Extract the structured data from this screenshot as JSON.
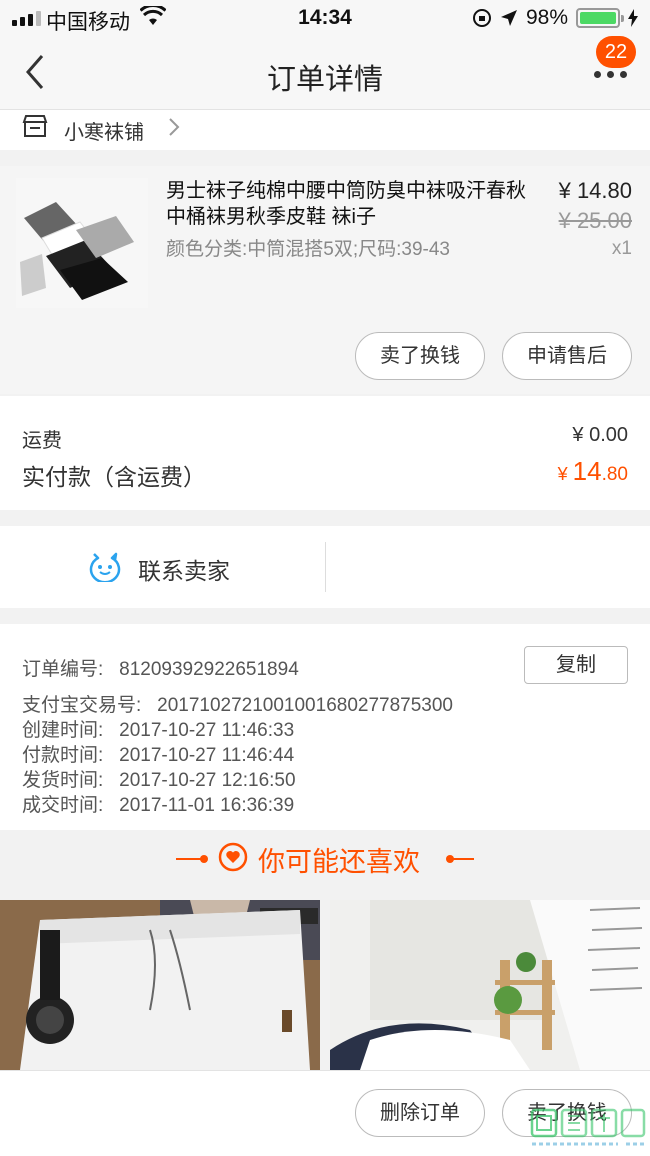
{
  "status_bar": {
    "carrier": "中国移动",
    "time": "14:34",
    "battery": "98%"
  },
  "nav": {
    "title": "订单详情",
    "badge_count": "22"
  },
  "shop": {
    "name": "小寒袜铺"
  },
  "product": {
    "title": "男士袜子纯棉中腰中筒防臭中袜吸汗春秋中桶袜男秋季皮鞋 袜i子",
    "sku": "颜色分类:中筒混搭5双;尺码:39-43",
    "price": "¥ 14.80",
    "original_price": "¥ 25.00",
    "quantity": "x1",
    "actions": [
      "卖了换钱",
      "申请售后"
    ]
  },
  "fees": {
    "shipping_label": "运费",
    "shipping_value": "¥ 0.00",
    "paid_label": "实付款（含运费）",
    "paid_symbol": "¥ ",
    "paid_int": "14",
    "paid_dec": ".80"
  },
  "contact": {
    "label": "联系卖家"
  },
  "order_info": {
    "order_number_label": "订单编号:",
    "order_number": "81209392922651894",
    "copy_label": "复制",
    "alipay_label": "支付宝交易号:",
    "alipay_number": "2017102721001001680277875300",
    "created_label": "创建时间:",
    "created": "2017-10-27 11:46:33",
    "paid_label": "付款时间:",
    "paid": "2017-10-27 11:46:44",
    "shipped_label": "发货时间:",
    "shipped": "2017-10-27 12:16:50",
    "completed_label": "成交时间:",
    "completed": "2017-11-01 16:36:39"
  },
  "recommendations": {
    "title": "你可能还喜欢"
  },
  "bottom_actions": [
    "删除订单",
    "卖了换钱"
  ],
  "colors": {
    "accent": "#ff5000",
    "battery": "#4cd964",
    "contact_icon": "#2ba3ee"
  },
  "icons": [
    "signal-icon",
    "wifi-icon",
    "rotation-lock-icon",
    "location-arrow-icon",
    "battery-icon",
    "back-chevron-icon",
    "more-icon",
    "shop-icon",
    "chevron-right-icon",
    "chat-face-icon",
    "heart-icon"
  ]
}
